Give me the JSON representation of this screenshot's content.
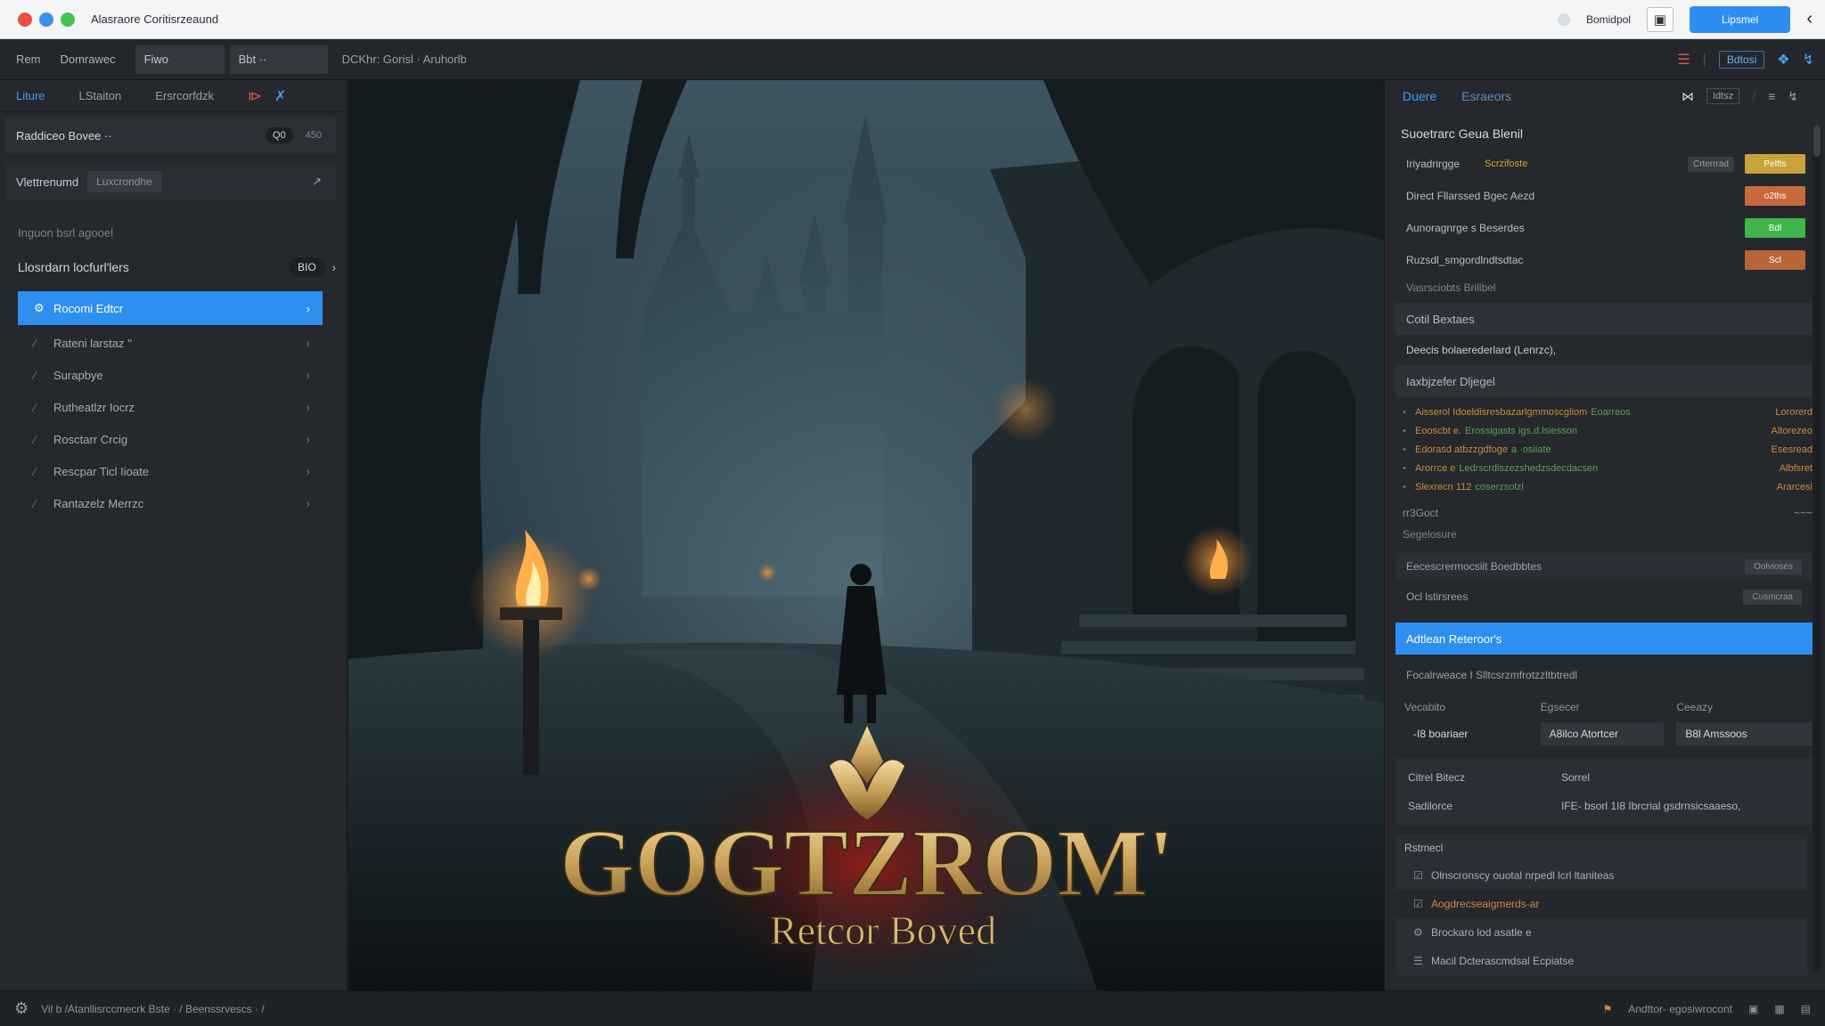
{
  "titlebar": {
    "app_title": "Alasraore Coritisrzeaund",
    "right_label": "Bomidpol",
    "primary_label": "Lipsmel",
    "dot_colors": [
      "#e94f43",
      "#3d8ef0",
      "#47c24f"
    ]
  },
  "menubar": {
    "items": [
      "Rem",
      "Domrawec"
    ],
    "box1": "Fiwo",
    "box2": "Bbt ··",
    "path": "DCKhr: Gorisl · Aruhorlb",
    "right_button": "Bdtosi"
  },
  "left_panel": {
    "tabs": [
      "Liture",
      "LStaiton",
      "Ersrcorfdzk"
    ],
    "section_title": "Raddiceo Bovee ··",
    "toggle_on": "Q0",
    "toggle_off": "450",
    "filter_label": "Vlettrenumd",
    "filter_value": "Luxcrondhe",
    "hint": "Inguon bsrl agooel",
    "group_label": "Llosrdarn locfurl'lers",
    "group_count": "BIO",
    "items": [
      {
        "label": "Rocomi Edtcr",
        "icon": "settings-icon",
        "active": true
      },
      {
        "label": "Rateni larstaz ''",
        "icon": "pencil-icon",
        "active": false
      },
      {
        "label": "Surapbye",
        "icon": "pencil-icon",
        "active": false
      },
      {
        "label": "Rutheatlzr Iocrz",
        "icon": "pencil-icon",
        "active": false
      },
      {
        "label": "Rosctarr Crcig",
        "icon": "pencil-icon",
        "active": false
      },
      {
        "label": "Rescpar Ticl Iioate",
        "icon": "pencil-icon",
        "active": false
      },
      {
        "label": "Rantazelz Merrzc",
        "icon": "pencil-icon",
        "active": false
      }
    ]
  },
  "artwork": {
    "title_main": "GOGTZROM'",
    "title_sub": "Retcor Boved"
  },
  "right_panel": {
    "tabs": [
      "Duere",
      "Esraeors"
    ],
    "tab_box": "Idtsz",
    "title": "Suoetrarc Geua Blenil",
    "props": [
      {
        "key": "Iriyadrirgge",
        "value": "Scrzifoste",
        "ghost": "Crterrrad",
        "chip": "Pelfts",
        "chip_color": "#c9a23a"
      },
      {
        "key": "Direct Fllarssed Bgec Aezd",
        "value": "",
        "ghost": "",
        "chip": "o2ths",
        "chip_color": "#c8683d"
      },
      {
        "key": "Aunoragnrge s Beserdes",
        "value": "",
        "ghost": "",
        "chip": "Bdl",
        "chip_color": "#3fb54a"
      },
      {
        "key": "Ruzsdl_smgordlndtsdtac",
        "value": "",
        "ghost": "",
        "chip": "Scl",
        "chip_color": "#b9653a"
      }
    ],
    "sub1": "Vasrsciobts Brillbel",
    "band1": "Cotil Bextaes",
    "line1": "Deecis bolaerederlard (Lenrzc),",
    "band2": "Iaxbjzefer Dljegel",
    "logs": [
      {
        "t": "Aisserol Idoeldisresbazarlgmmoscgliom",
        "t2": "Eoarreos",
        "r": "Lororerd"
      },
      {
        "t": "Eooscbt e.",
        "t2": "Erossigasts igs.d.lsiesson",
        "r": "Altorezeo"
      },
      {
        "t": "Edorasd atbzzgdfoge",
        "t2": "a ·osiiate",
        "r": "Esesread"
      },
      {
        "t": "Arorrce e",
        "t2": "Ledrscrdiszezshedzsdecdacsen",
        "r": "Albfsret"
      },
      {
        "t": "Slexrecn 112",
        "t2": "coserzsolzl",
        "r": "Ararcesi"
      }
    ],
    "small_left": "rr3Goct",
    "small_right": "~~~",
    "sub2": "Segelosure",
    "item1": "Eecescrermocsiit Boedbbtes",
    "item1_btn": "Oolvioses",
    "row_label": "Ocl lstirsrees",
    "row_btn": "Cusmcraa",
    "blue_bar": "Adtlean Reteroor's",
    "item2": "Focalrweace I Slltcsrzmfrotzzltbtredl",
    "grid_headers": [
      "Vecabito",
      "Egsecer",
      "Ceeazy"
    ],
    "grid_values": [
      "-I8 boariaer",
      "A8ilco Atortcer",
      "B8l Amssoos"
    ],
    "kv": [
      {
        "k": "Citrel Bitecz",
        "v": "Sorrel"
      },
      {
        "k": "Sadilorce",
        "v": "IFE- bsorl 1I8 Ibrcrial gsdrnsicsaaeso,"
      }
    ],
    "list_header": "Rstmecl",
    "list_items": [
      {
        "label": "Olnscronscy ouotal nrpedl lcrl ltaniteas",
        "icon": "check-icon",
        "hl": false
      },
      {
        "label": "Aogdrecseaigmerds-ar",
        "icon": "check-icon",
        "hl": true
      },
      {
        "label": "Brockaro lod asatle e",
        "icon": "gear-icon",
        "hl": false
      },
      {
        "label": "Macil Dcterascmdsal Ecpiatse",
        "icon": "doc-icon",
        "hl": false
      }
    ]
  },
  "status": {
    "text": "Vil b  /Atanllisrccmecrk Bste ·  /     Beenssrvescs · /",
    "right_text": "Andttor-  egosiwrocont"
  }
}
